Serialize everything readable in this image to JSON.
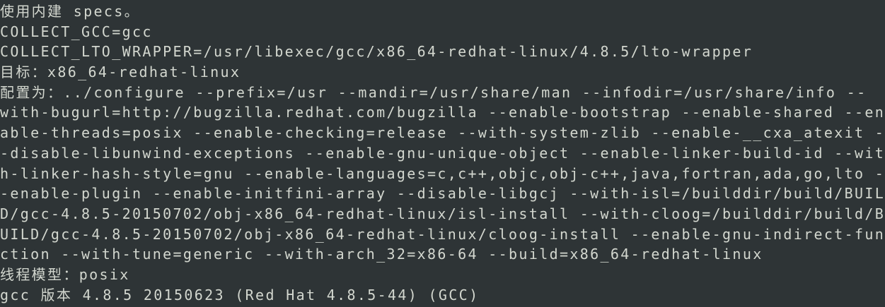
{
  "terminal": {
    "lines": [
      "使用内建 specs。",
      "COLLECT_GCC=gcc",
      "COLLECT_LTO_WRAPPER=/usr/libexec/gcc/x86_64-redhat-linux/4.8.5/lto-wrapper",
      "目标：x86_64-redhat-linux",
      "配置为：../configure --prefix=/usr --mandir=/usr/share/man --infodir=/usr/share/info --",
      "with-bugurl=http://bugzilla.redhat.com/bugzilla --enable-bootstrap --enable-shared --en",
      "able-threads=posix --enable-checking=release --with-system-zlib --enable-__cxa_atexit -",
      "-disable-libunwind-exceptions --enable-gnu-unique-object --enable-linker-build-id --wit",
      "h-linker-hash-style=gnu --enable-languages=c,c++,objc,obj-c++,java,fortran,ada,go,lto -",
      "-enable-plugin --enable-initfini-array --disable-libgcj --with-isl=/builddir/build/BUIL",
      "D/gcc-4.8.5-20150702/obj-x86_64-redhat-linux/isl-install --with-cloog=/builddir/build/B",
      "UILD/gcc-4.8.5-20150702/obj-x86_64-redhat-linux/cloog-install --enable-gnu-indirect-fun",
      "ction --with-tune=generic --with-arch_32=x86-64 --build=x86_64-redhat-linux",
      "线程模型：posix",
      "gcc 版本 4.8.5 20150623 (Red Hat 4.8.5-44) (GCC)"
    ]
  }
}
